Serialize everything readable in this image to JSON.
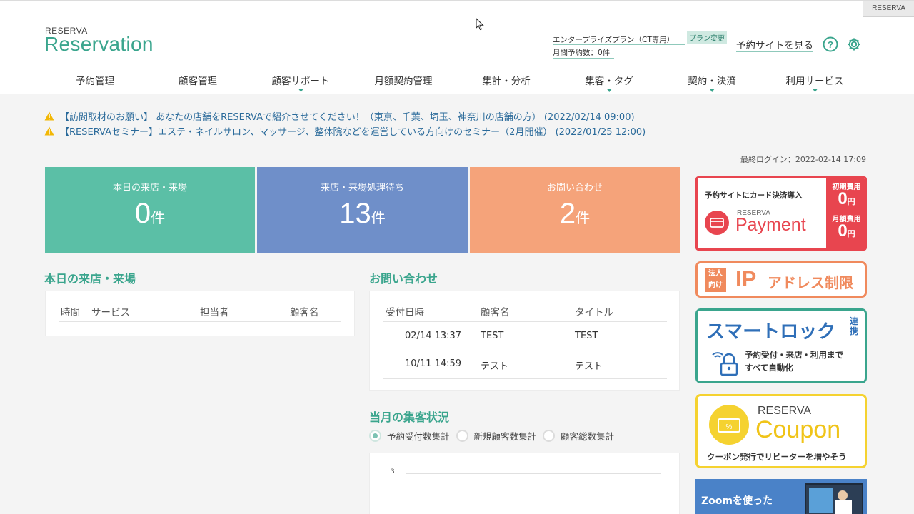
{
  "topbar": {
    "tab_label": "RESERVA"
  },
  "brand": {
    "small": "RESERVA",
    "name": "Reservation"
  },
  "plan": {
    "name": "エンタープライズプラン（CT専用）",
    "change_label": "プラン変更",
    "monthly_count": "月間予約数：0件"
  },
  "header_links": {
    "site": "予約サイトを見る"
  },
  "nav": [
    {
      "label": "予約管理",
      "caret": false
    },
    {
      "label": "顧客管理",
      "caret": false
    },
    {
      "label": "顧客サポート",
      "caret": true
    },
    {
      "label": "月額契約管理",
      "caret": false
    },
    {
      "label": "集計・分析",
      "caret": false
    },
    {
      "label": "集客・タグ",
      "caret": true
    },
    {
      "label": "契約・決済",
      "caret": true
    },
    {
      "label": "利用サービス",
      "caret": true
    }
  ],
  "notices": [
    {
      "text": "【訪問取材のお願い】 あなたの店舗をRESERVAで紹介させてください！（東京、千葉、埼玉、神奈川の店舗の方） (2022/02/14 09:00)"
    },
    {
      "text": "【RESERVAセミナー】エステ・ネイルサロン、マッサージ、整体院などを運営している方向けのセミナー（2月開催） (2022/01/25 12:00)"
    }
  ],
  "last_login": "最終ログイン：2022-02-14 17:09",
  "stats": [
    {
      "title": "本日の来店・来場",
      "value": "0",
      "unit": "件",
      "color": "#5bbfa6"
    },
    {
      "title": "来店・来場処理待ち",
      "value": "13",
      "unit": "件",
      "color": "#6f8fc9"
    },
    {
      "title": "お問い合わせ",
      "value": "2",
      "unit": "件",
      "color": "#f5a37a"
    }
  ],
  "today_visits": {
    "title": "本日の来店・来場",
    "columns": [
      "時間",
      "サービス",
      "担当者",
      "顧客名"
    ]
  },
  "inquiries": {
    "title": "お問い合わせ",
    "columns": [
      "受付日時",
      "顧客名",
      "タイトル"
    ],
    "rows": [
      [
        "02/14 13:37",
        "TEST",
        "TEST"
      ],
      [
        "10/11 14:59",
        "テスト",
        "テスト"
      ]
    ]
  },
  "monthly": {
    "title": "当月の集客状況",
    "options": [
      {
        "label": "予約受付数集計",
        "selected": true
      },
      {
        "label": "新規顧客数集計",
        "selected": false
      },
      {
        "label": "顧客総数集計",
        "selected": false
      }
    ],
    "y_tick": "3"
  },
  "banners": {
    "payment": {
      "headline": "予約サイトにカード決済導入",
      "brand": "RESERVA",
      "name": "Payment",
      "fee1_label": "初期費用",
      "fee1_value": "0",
      "fee2_label": "月額費用",
      "fee2_value": "0",
      "unit": "円"
    },
    "ip": {
      "tag1": "法人",
      "tag2": "向け",
      "big": "IP",
      "rest": "アドレス制限"
    },
    "smartlock": {
      "title": "スマートロック",
      "tag": "連携",
      "line1": "予約受付・来店・利用まで",
      "line2": "すべて自動化"
    },
    "coupon": {
      "brand": "RESERVA",
      "name": "Coupon",
      "caption": "クーポン発行でリピーターを増やそう"
    },
    "zoom": {
      "text": "Zoomを使った"
    }
  },
  "colors": {
    "accent": "#3aa58d",
    "link": "#2a6a9a",
    "payment_red": "#e8454f",
    "ip_orange": "#f08a5d",
    "lock_teal": "#3aa58d",
    "coupon_yellow": "#f5d230"
  }
}
